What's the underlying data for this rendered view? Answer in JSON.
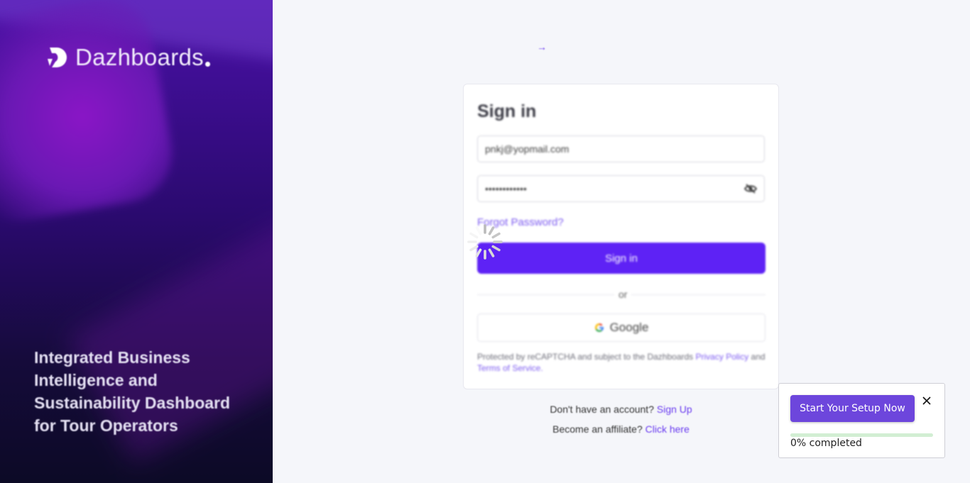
{
  "brand": {
    "name": "Dazhboards"
  },
  "tagline": "Integrated Business Intelligence and Sustainability Dashboard for Tour Operators",
  "signin": {
    "title": "Sign in",
    "email_value": "pnkj@yopmail.com",
    "password_value": "••••••••••••",
    "forgot_label": "Forgot Password?",
    "submit_label": "Sign in",
    "or_label": "or",
    "google_label": "Google",
    "legal_prefix": "Protected by reCAPTCHA and subject to the Dazhboards",
    "privacy_label": "Privacy Policy",
    "legal_and": "and",
    "terms_label": "Terms of Service."
  },
  "footer": {
    "account_text": "Don't have an account?",
    "signup_label": "Sign Up",
    "affiliate_text": "Become an affiliate?",
    "affiliate_link": "Click here"
  },
  "setup": {
    "button_label": "Start Your Setup Now",
    "progress": 0,
    "progress_label": "0% completed"
  },
  "colors": {
    "accent": "#5e22f5",
    "link": "#7c5af0",
    "setup_button": "#6d46dc",
    "progress_track": "#d2eed3"
  },
  "icons": [
    "dazhboards-logo-icon",
    "eye-off-icon",
    "google-icon",
    "loading-spinner-icon",
    "close-icon"
  ]
}
